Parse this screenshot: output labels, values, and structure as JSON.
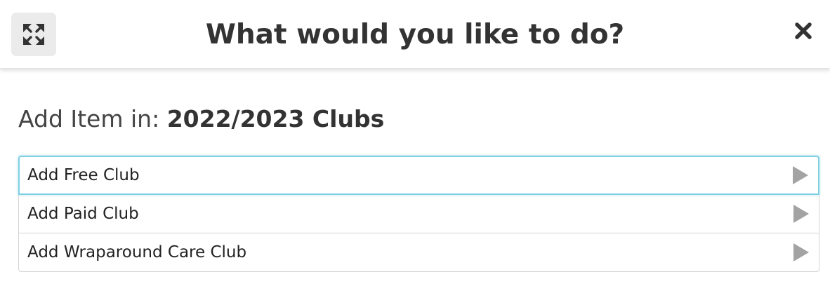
{
  "dialog": {
    "title": "What would you like to do?",
    "expand_icon": "expand-arrows-icon",
    "close_icon": "close-icon"
  },
  "heading": {
    "prefix": "Add Item in: ",
    "context": "2022/2023 Clubs"
  },
  "options": [
    {
      "label": "Add Free Club",
      "icon": "chevron-right-icon",
      "active": true
    },
    {
      "label": "Add Paid Club",
      "icon": "chevron-right-icon",
      "active": false
    },
    {
      "label": "Add Wraparound Care Club",
      "icon": "chevron-right-icon",
      "active": false
    }
  ],
  "colors": {
    "focus_border": "#7fd0e3",
    "arrow": "#a3a3a3",
    "text": "#333333"
  }
}
